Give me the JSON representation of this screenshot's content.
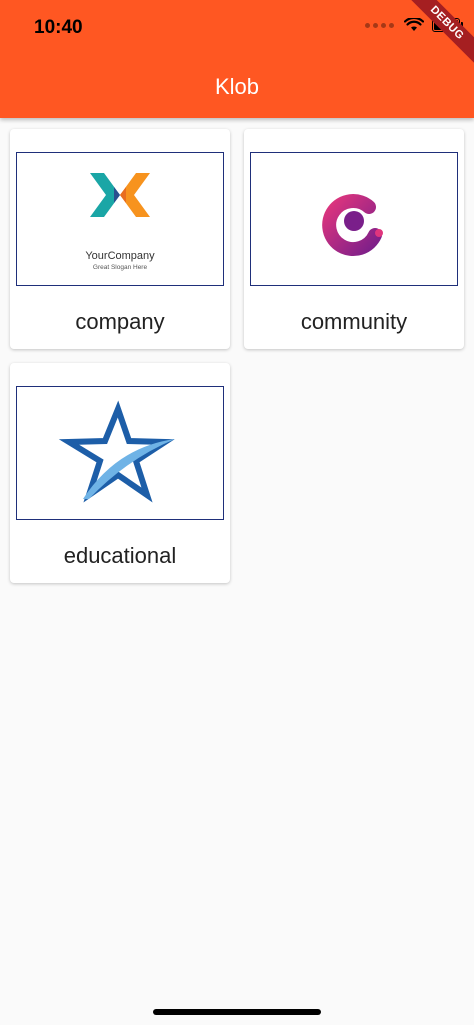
{
  "status_bar": {
    "time": "10:40"
  },
  "debug_banner": "DEBUG",
  "appbar": {
    "title": "Klob"
  },
  "cards": [
    {
      "label": "company",
      "logo_text": "YourCompany",
      "logo_slogan": "Great Slogan Here"
    },
    {
      "label": "community"
    },
    {
      "label": "educational"
    }
  ],
  "colors": {
    "appbar": "#ff5722",
    "frame": "#1f2f7a",
    "background": "#fafafa"
  }
}
